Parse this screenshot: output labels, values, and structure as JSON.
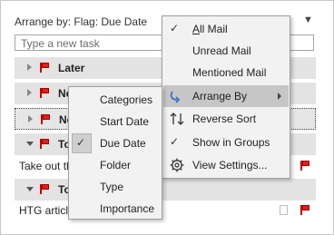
{
  "header": {
    "arrange_text": "Arrange by: Flag: Due Date"
  },
  "task_input": {
    "placeholder": "Type a new task"
  },
  "groups": [
    {
      "label": "Later"
    },
    {
      "label": "Ne"
    },
    {
      "label": "Ne"
    },
    {
      "label": "To"
    },
    {
      "label": "To"
    }
  ],
  "tasks": [
    {
      "text": "Take out th"
    },
    {
      "text": "HTG article"
    }
  ],
  "main_menu": {
    "all_mail": "All Mail",
    "unread_mail": "Unread Mail",
    "mentioned_mail": "Mentioned Mail",
    "arrange_by": "Arrange By",
    "reverse_sort": "Reverse Sort",
    "show_in_groups": "Show in Groups",
    "view_settings": "View Settings..."
  },
  "sub_menu": {
    "categories": "Categories",
    "start_date": "Start Date",
    "due_date": "Due Date",
    "folder": "Folder",
    "type": "Type",
    "importance": "Importance"
  },
  "icons": {
    "check": "checkmark-icon",
    "arrange": "arrange-by-icon",
    "sort": "reverse-sort-icon",
    "settings": "gear-icon",
    "flag": "flag-icon"
  },
  "colors": {
    "flag_red": "#e0201c",
    "menu_bg": "#f2f2f2",
    "hover": "#c6c6c6",
    "arrange_icon": "#2b6cc4"
  }
}
